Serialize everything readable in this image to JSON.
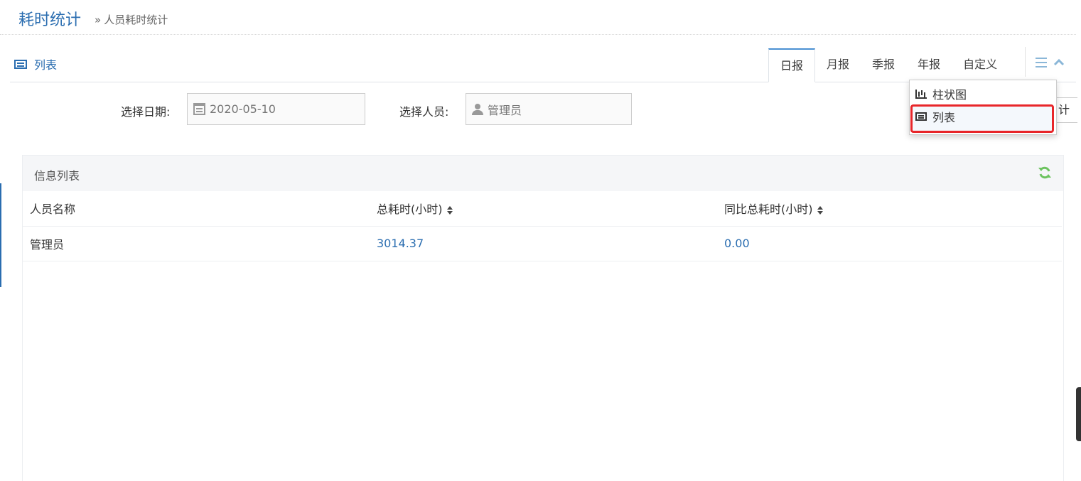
{
  "breadcrumb": {
    "title": "耗时统计",
    "separator": "»",
    "current": "人员耗时统计"
  },
  "widget": {
    "label": "列表",
    "tabs": [
      {
        "label": "日报",
        "active": true
      },
      {
        "label": "月报",
        "active": false
      },
      {
        "label": "季报",
        "active": false
      },
      {
        "label": "年报",
        "active": false
      },
      {
        "label": "自定义",
        "active": false
      }
    ],
    "dropdown": {
      "items": [
        {
          "label": "柱状图",
          "icon": "bar-chart-icon"
        },
        {
          "label": "列表",
          "icon": "list-icon",
          "highlighted": true
        }
      ]
    }
  },
  "filters": {
    "date_label": "选择日期:",
    "date_value": "2020-05-10",
    "person_label": "选择人员:",
    "person_value": "管理员",
    "stat_button_label": "计"
  },
  "panel": {
    "title": "信息列表",
    "columns": [
      "人员名称",
      "总耗时(小时)",
      "同比总耗时(小时)"
    ],
    "rows": [
      [
        "管理员",
        "3014.37",
        "0.00"
      ]
    ]
  },
  "colors": {
    "accent": "#2a6db0",
    "highlight_border": "#e8262a",
    "refresh": "#6cc35f"
  }
}
